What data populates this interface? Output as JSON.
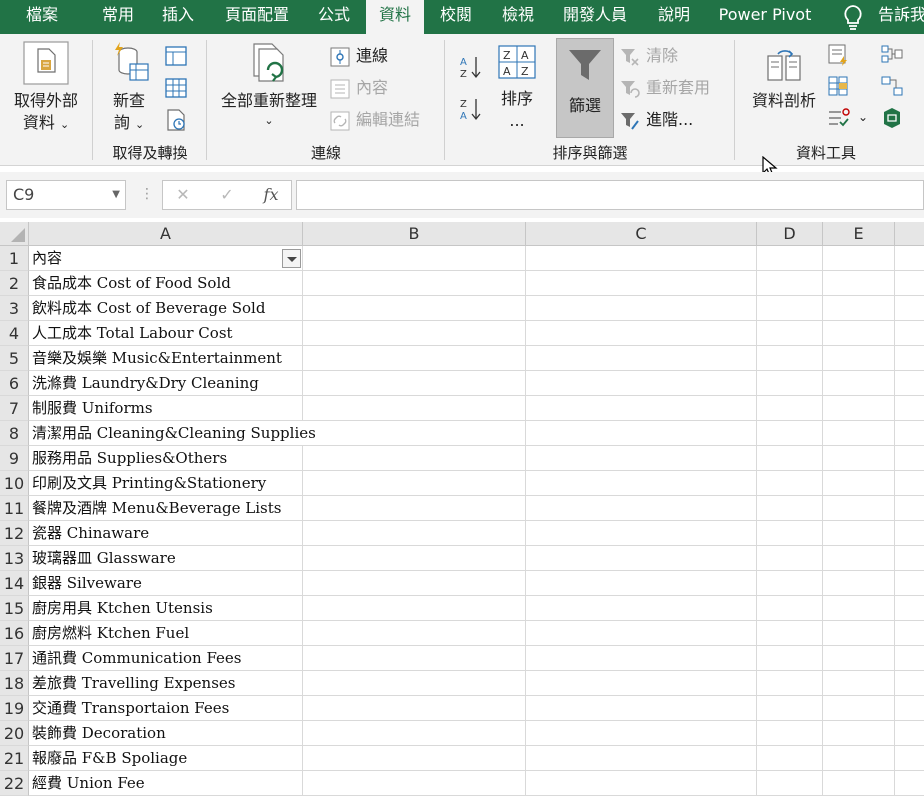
{
  "ribbon_tabs": [
    {
      "label": "檔案",
      "active": false
    },
    {
      "label": "常用",
      "active": false
    },
    {
      "label": "插入",
      "active": false
    },
    {
      "label": "頁面配置",
      "active": false
    },
    {
      "label": "公式",
      "active": false
    },
    {
      "label": "資料",
      "active": true
    },
    {
      "label": "校閱",
      "active": false
    },
    {
      "label": "檢視",
      "active": false
    },
    {
      "label": "開發人員",
      "active": false
    },
    {
      "label": "說明",
      "active": false
    },
    {
      "label": "Power Pivot",
      "active": false
    }
  ],
  "tell_me": {
    "label": "告訴我",
    "icon": "lightbulb-icon"
  },
  "groups": {
    "get_transform": {
      "label": "取得及轉換",
      "get_external": {
        "line1": "取得外部",
        "line2": "資料",
        "icon": "external-data-icon"
      },
      "new_query": {
        "line1": "新查",
        "line2": "詢",
        "icon": "new-query-icon"
      }
    },
    "connections": {
      "label": "連線",
      "refresh_all": {
        "label": "全部重新整理",
        "icon": "refresh-all-icon"
      },
      "connections": {
        "label": "連線",
        "icon": "connections-icon"
      },
      "properties": {
        "label": "內容",
        "icon": "properties-icon"
      },
      "edit_links": {
        "label": "編輯連結",
        "icon": "edit-links-icon"
      }
    },
    "sort_filter": {
      "label": "排序與篩選",
      "sort": {
        "line1": "排序",
        "line2": "...",
        "icon": "sort-dialog-icon"
      },
      "filter": {
        "label": "篩選",
        "icon": "filter-funnel-icon",
        "pressed": true
      },
      "clear": {
        "label": "清除",
        "icon": "clear-filter-icon"
      },
      "reapply": {
        "label": "重新套用",
        "icon": "reapply-icon"
      },
      "advanced": {
        "label": "進階...",
        "icon": "advanced-filter-icon"
      }
    },
    "data_tools": {
      "label": "資料工具",
      "text_to_columns": {
        "label": "資料剖析",
        "icon": "text-to-columns-icon"
      }
    }
  },
  "formula_bar": {
    "name_box": "C9",
    "cancel": "✕",
    "enter": "✓",
    "fx": "fx",
    "formula": ""
  },
  "columns": [
    "A",
    "B",
    "C",
    "D",
    "E"
  ],
  "rows": [
    {
      "n": "1",
      "a": "內容"
    },
    {
      "n": "2",
      "a": "食品成本 Cost of Food Sold"
    },
    {
      "n": "3",
      "a": "飲料成本 Cost of Beverage Sold"
    },
    {
      "n": "4",
      "a": "人工成本 Total Labour Cost"
    },
    {
      "n": "5",
      "a": "音樂及娛樂 Music&Entertainment"
    },
    {
      "n": "6",
      "a": "洗滌費 Laundry&Dry Cleaning"
    },
    {
      "n": "7",
      "a": "制服費 Uniforms"
    },
    {
      "n": "8",
      "a": "清潔用品 Cleaning&Cleaning Supplies"
    },
    {
      "n": "9",
      "a": "服務用品 Supplies&Others"
    },
    {
      "n": "10",
      "a": "印刷及文具 Printing&Stationery"
    },
    {
      "n": "11",
      "a": "餐牌及酒牌 Menu&Beverage Lists"
    },
    {
      "n": "12",
      "a": "瓷器 Chinaware"
    },
    {
      "n": "13",
      "a": "玻璃器皿 Glassware"
    },
    {
      "n": "14",
      "a": "銀器 Silveware"
    },
    {
      "n": "15",
      "a": "廚房用具 Ktchen Utensis"
    },
    {
      "n": "16",
      "a": "廚房燃料 Ktchen Fuel"
    },
    {
      "n": "17",
      "a": "通訊費 Communication Fees"
    },
    {
      "n": "18",
      "a": "差旅費 Travelling Expenses"
    },
    {
      "n": "19",
      "a": "交通費 Transportaion Fees"
    },
    {
      "n": "20",
      "a": "裝飾費 Decoration"
    },
    {
      "n": "21",
      "a": "報廢品 F&B Spoliage"
    },
    {
      "n": "22",
      "a": "經費 Union Fee"
    }
  ],
  "colors": {
    "ribbon_green": "#217346",
    "ribbon_bg": "#f3f3f3",
    "header_gray": "#e6e6e6"
  }
}
